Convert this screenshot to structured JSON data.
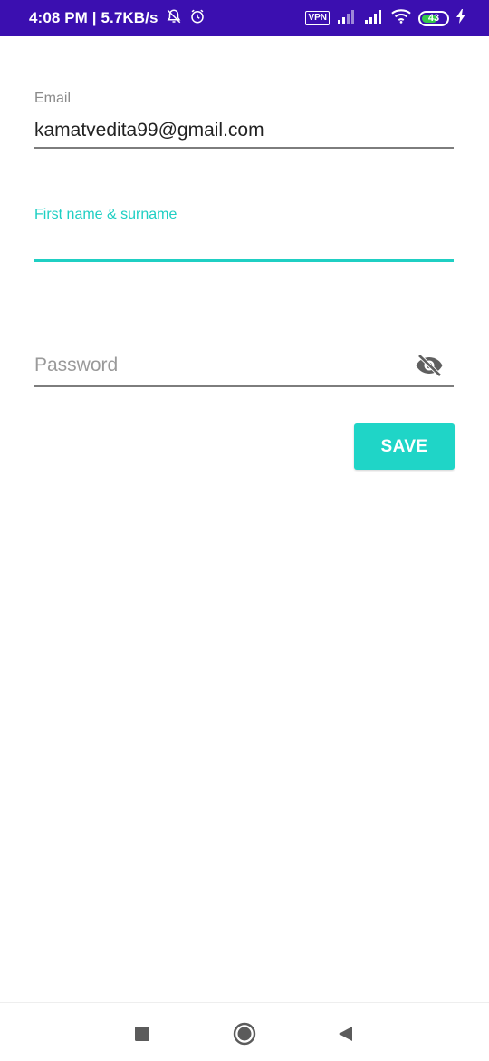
{
  "status_bar": {
    "time_and_speed": "4:08 PM | 5.7KB/s",
    "vpn": "VPN",
    "battery_level": "43",
    "background_color": "#3b0fb0",
    "icons": [
      "alarm-off-icon",
      "alarm-clock-icon",
      "signal-icon",
      "signal-icon",
      "wifi-icon",
      "battery-icon",
      "charging-bolt-icon"
    ]
  },
  "form": {
    "email": {
      "label": "Email",
      "value": "kamatvedita99@gmail.com"
    },
    "name": {
      "label": "First name & surname",
      "value": ""
    },
    "password": {
      "placeholder": "Password",
      "toggle_icon": "eye-off-icon"
    },
    "accent_color": "#1fd5c7"
  },
  "actions": {
    "save_label": "SAVE"
  },
  "nav_bar": {
    "icons": [
      "recents-square-icon",
      "home-circle-icon",
      "back-triangle-icon"
    ]
  }
}
